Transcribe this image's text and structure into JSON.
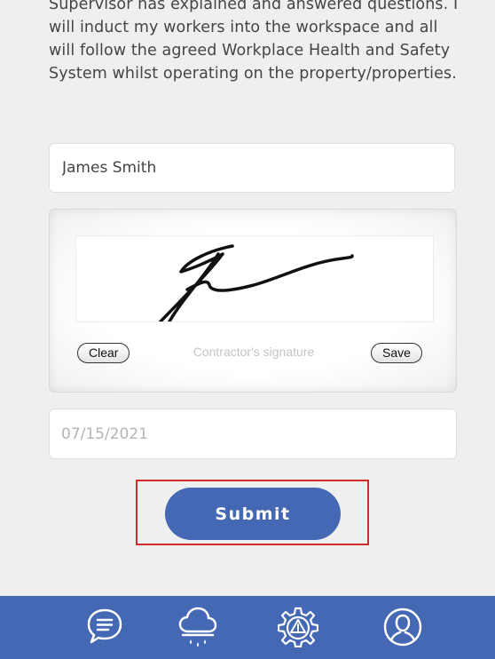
{
  "agreement": {
    "text": "Supervisor has explained and answered questions. I will induct my workers into the workspace and all will follow the agreed Workplace Health and Safety System whilst operating on the property/properties."
  },
  "form": {
    "name_value": "James Smith",
    "signature": {
      "caption": "Contractor's signature",
      "clear_label": "Clear",
      "save_label": "Save"
    },
    "date_placeholder": "07/15/2021",
    "submit_label": "Submit"
  },
  "bottom_nav": {
    "items": [
      {
        "icon": "chat-bubble-icon"
      },
      {
        "icon": "rain-cloud-icon"
      },
      {
        "icon": "gear-warning-icon"
      },
      {
        "icon": "user-profile-icon"
      }
    ]
  },
  "colors": {
    "accent": "#4468b3",
    "background": "#efefef",
    "highlight": "#d32b2b"
  }
}
